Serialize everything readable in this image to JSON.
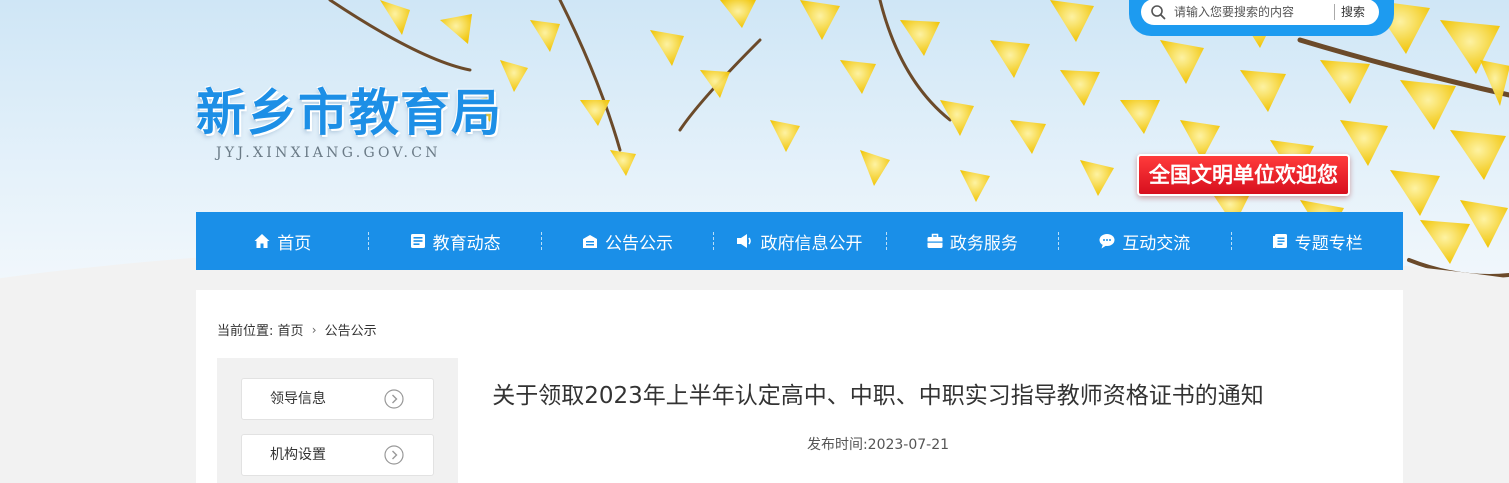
{
  "site": {
    "title": "新乡市教育局",
    "domain": "JYJ.XINXIANG.GOV.CN",
    "welcome": "全国文明单位欢迎您"
  },
  "search": {
    "placeholder": "请输入您要搜索的内容",
    "button": "搜索"
  },
  "nav": {
    "items": [
      {
        "label": "首页",
        "icon": "home-icon"
      },
      {
        "label": "教育动态",
        "icon": "news-icon"
      },
      {
        "label": "公告公示",
        "icon": "notice-icon"
      },
      {
        "label": "政府信息公开",
        "icon": "megaphone-icon"
      },
      {
        "label": "政务服务",
        "icon": "briefcase-icon"
      },
      {
        "label": "互动交流",
        "icon": "chat-icon"
      },
      {
        "label": "专题专栏",
        "icon": "column-icon"
      }
    ]
  },
  "breadcrumb": {
    "prefix": "当前位置:",
    "items": [
      "首页",
      "公告公示"
    ],
    "separator": "›"
  },
  "sidebar": {
    "items": [
      {
        "label": "领导信息"
      },
      {
        "label": "机构设置"
      }
    ]
  },
  "article": {
    "title": "关于领取2023年上半年认定高中、中职、中职实习指导教师资格证书的通知",
    "publish_label": "发布时间:",
    "publish_date": "2023-07-21"
  },
  "colors": {
    "brand_blue": "#1a8fe8",
    "banner_red": "#d70f1e",
    "leaf_yellow": "#f6d21c"
  }
}
